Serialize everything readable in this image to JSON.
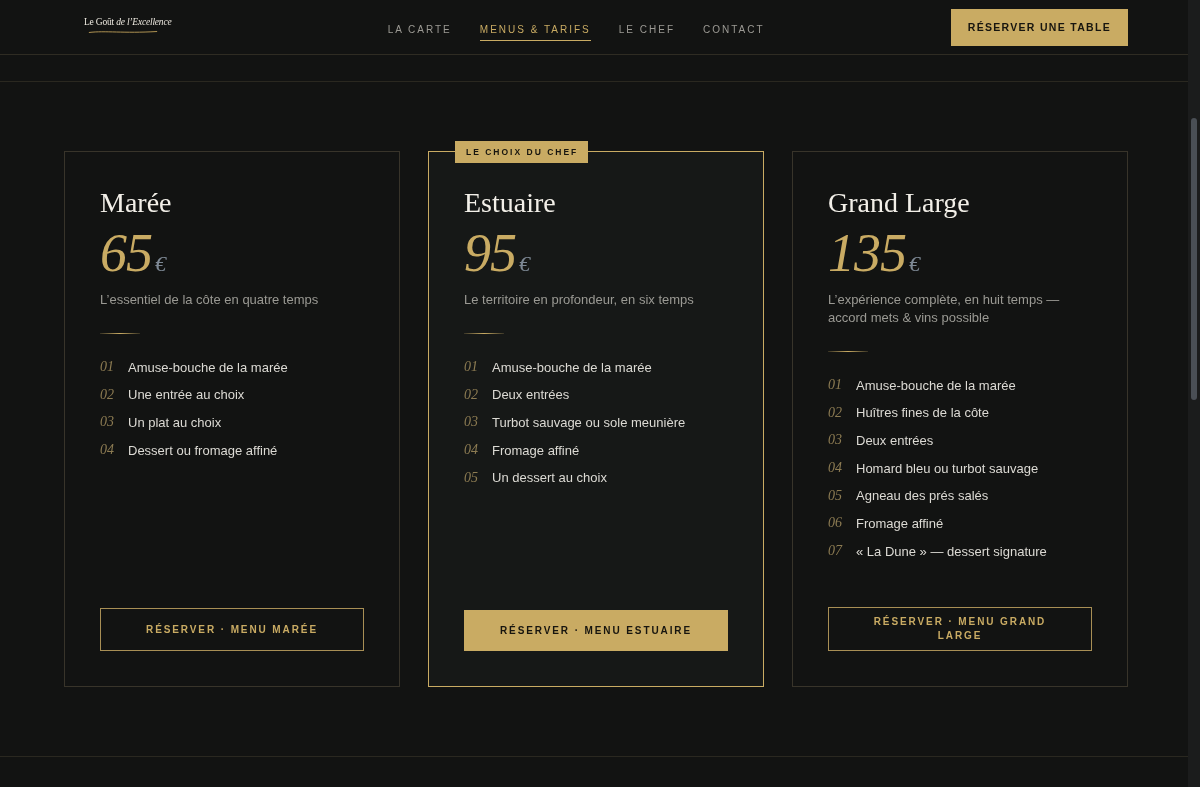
{
  "header": {
    "logo": "Le Goût *de l’Excellence*",
    "nav": [
      {
        "label": "LA CARTE",
        "selected": false
      },
      {
        "label": "MENUS & TARIFS",
        "selected": true
      },
      {
        "label": "LE CHEF",
        "selected": false
      },
      {
        "label": "CONTACT",
        "selected": false
      }
    ],
    "cta": "RÉSERVER UNE TABLE"
  },
  "menus": [
    {
      "name": "Marée",
      "price": "65",
      "currency": "€",
      "description": "L’essentiel de la côte en quatre temps",
      "featured": false,
      "courses": [
        {
          "number": "01",
          "dish": "Amuse-bouche de la marée"
        },
        {
          "number": "02",
          "dish": "Une entrée au choix"
        },
        {
          "number": "03",
          "dish": "Un plat au choix"
        },
        {
          "number": "04",
          "dish": "Dessert ou fromage affiné"
        }
      ],
      "button": "RÉSERVER · MENU MARÉE"
    },
    {
      "name": "Estuaire",
      "price": "95",
      "currency": "€",
      "description": "Le territoire en profondeur, en six temps",
      "featured": true,
      "badge": "LE CHOIX DU CHEF",
      "courses": [
        {
          "number": "01",
          "dish": "Amuse-bouche de la marée"
        },
        {
          "number": "02",
          "dish": "Deux entrées"
        },
        {
          "number": "03",
          "dish": "Turbot sauvage ou sole meunière"
        },
        {
          "number": "04",
          "dish": "Fromage affiné"
        },
        {
          "number": "05",
          "dish": "Un dessert au choix"
        }
      ],
      "button": "RÉSERVER · MENU ESTUAIRE"
    },
    {
      "name": "Grand Large",
      "price": "135",
      "currency": "€",
      "description": "L’expérience complète, en huit temps — accord mets & vins possible",
      "featured": false,
      "courses": [
        {
          "number": "01",
          "dish": "Amuse-bouche de la marée"
        },
        {
          "number": "02",
          "dish": "Huîtres fines de la côte"
        },
        {
          "number": "03",
          "dish": "Deux entrées"
        },
        {
          "number": "04",
          "dish": "Homard bleu ou turbot sauvage"
        },
        {
          "number": "05",
          "dish": "Agneau des prés salés"
        },
        {
          "number": "06",
          "dish": "Fromage affiné"
        },
        {
          "number": "07",
          "dish": "« La Dune » — dessert signature"
        }
      ],
      "button": "RÉSERVER · MENU GRAND LARGE"
    }
  ]
}
